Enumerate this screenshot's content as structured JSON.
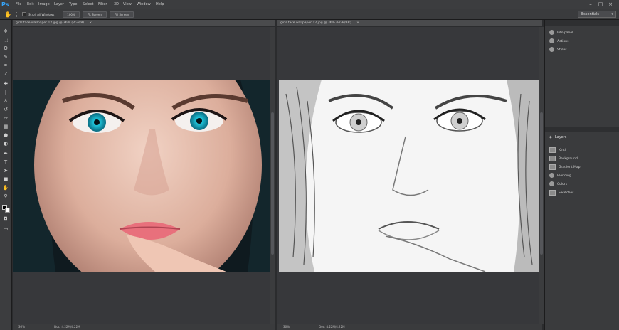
{
  "app": {
    "logo": "Ps"
  },
  "menu": [
    "File",
    "Edit",
    "Image",
    "Layer",
    "Type",
    "Select",
    "Filter",
    "3D",
    "View",
    "Window",
    "Help"
  ],
  "window_controls": [
    "–",
    "□",
    "×"
  ],
  "options_bar": {
    "checkbox_label": "Scroll All Windows",
    "buttons": [
      "100%",
      "Fit Screen",
      "Fill Screen"
    ],
    "workspace": "Essentials"
  },
  "documents": [
    {
      "tab": "girls face wallpaper 12.jpg @ 36% (RGB/8)",
      "status_zoom": "36%",
      "status_doc": "Doc: 4.22M/4.22M",
      "style": "color"
    },
    {
      "tab": "girls face wallpaper 12.jpg @ 36% (RGB/8#)",
      "status_zoom": "36%",
      "status_doc": "Doc: 4.22M/4.22M",
      "style": "sketch"
    }
  ],
  "panels": {
    "top": {
      "items": [
        "Info panel",
        "Actions",
        "Styles"
      ]
    },
    "layers": {
      "title": "Layers",
      "items": [
        "Kind",
        "Background",
        "Gradient Map",
        "Blending",
        "Colors",
        "Swatches"
      ]
    }
  },
  "colors": {
    "accent": "#36a3f7",
    "chrome": "#3c3d3f",
    "canvas": "#37383b"
  }
}
